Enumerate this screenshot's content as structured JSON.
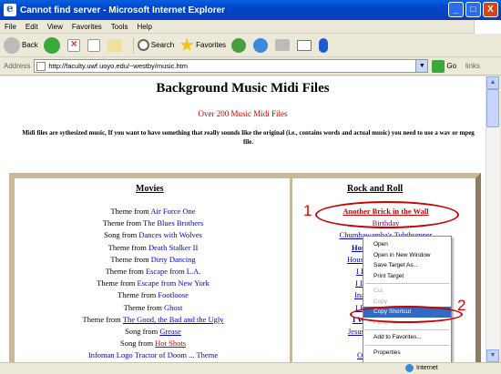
{
  "window": {
    "title": "Cannot find server - Microsoft Internet Explorer",
    "buttons": [
      "_",
      "□",
      "X"
    ]
  },
  "menu": [
    "File",
    "Edit",
    "View",
    "Favorites",
    "Tools",
    "Help"
  ],
  "toolbar": {
    "back": "Back",
    "search": "Search",
    "favorites": "Favorites",
    "media_icon": "media-icon",
    "history_icon": "history-icon"
  },
  "address": {
    "label": "Address",
    "url": "http://faculty.uwf.uoyo.edu/~westby/music.htm",
    "go": "Go",
    "links": "links"
  },
  "page": {
    "title": "Background Music Midi Files",
    "subtitle": "Over 200 Music Midi Files",
    "note": "Midi files are sythesized music, If you want to have something that really sounds like the original (i.e., contains words and actual music) you need to use a wav or mpeg file."
  },
  "movies": {
    "heading": "Movies",
    "rows": [
      {
        "prefix": "Theme from ",
        "link": "Air Force One"
      },
      {
        "prefix": "Theme from ",
        "link": "The Blues Brothers"
      },
      {
        "prefix": "Song from ",
        "link": "Dances with Wolves"
      },
      {
        "prefix": "Theme from ",
        "link": "Death Stalker II"
      },
      {
        "prefix": "Theme from ",
        "link": "Dirty Dancing"
      },
      {
        "prefix": "Theme from ",
        "link": "Escape from L.A."
      },
      {
        "prefix": "Theme from ",
        "link": "Escape from New York"
      },
      {
        "prefix": "Theme from ",
        "link": "Footloose"
      },
      {
        "prefix": "Theme from ",
        "link": "Ghost"
      },
      {
        "prefix": "Theme from ",
        "link": "The Good, the Bad and the Ugly"
      },
      {
        "prefix": "Song from ",
        "link": "Grease"
      },
      {
        "prefix": "Song from ",
        "link": "Hot Shots"
      }
    ],
    "partial_row": "Infoman Logo Tractor of Doom ... Theme"
  },
  "rock": {
    "heading": "Rock and Roll",
    "rows": [
      "Another Brick in the Wall",
      "Birthday",
      "Chumbawamba's Tubthumper",
      "Horse",
      "House o",
      "I Dig",
      "I Love",
      "Ina G",
      "I Put",
      "I Want",
      "Jesus C",
      "Ma",
      "Old T"
    ]
  },
  "context_menu": {
    "items": [
      "Open",
      "Open in New Window",
      "Save Target As...",
      "Print Target",
      "Cut",
      "Copy",
      "Copy Shortcut",
      "Paste",
      "Add to Favorites...",
      "Properties"
    ],
    "selected": "Copy Shortcut"
  },
  "annotations": {
    "one": "1",
    "two": "2"
  },
  "status": {
    "zone": "Internet"
  }
}
